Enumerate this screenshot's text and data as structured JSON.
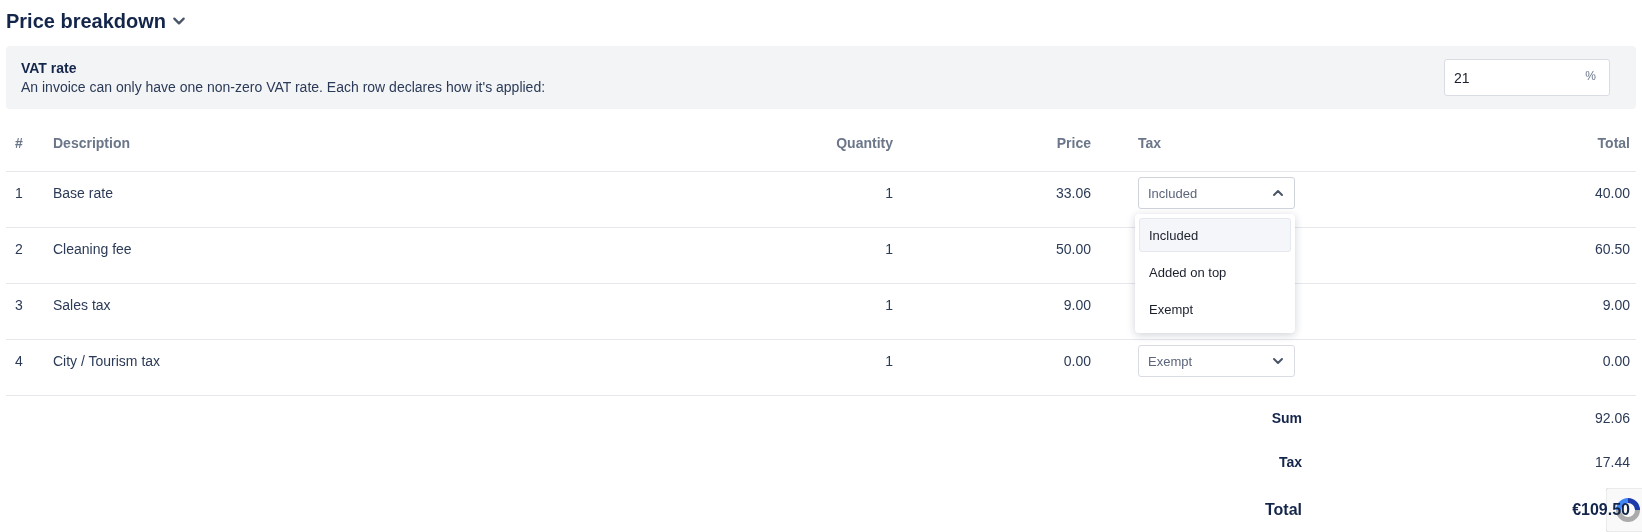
{
  "title": "Price breakdown",
  "vat": {
    "label": "VAT rate",
    "description": "An invoice can only have one non-zero VAT rate. Each row declares how it's applied:",
    "value": "21",
    "unit": "%"
  },
  "table": {
    "columns": [
      "#",
      "Description",
      "Quantity",
      "Price",
      "Tax",
      "Total"
    ],
    "rows": [
      {
        "number": "1",
        "description": "Base rate",
        "quantity": "1",
        "price": "33.06",
        "tax": {
          "value": "Included",
          "expanded": true,
          "options": [
            {
              "label": "Included",
              "selected": true
            },
            {
              "label": "Added on top",
              "selected": false
            },
            {
              "label": "Exempt",
              "selected": false
            }
          ]
        },
        "total": "40.00"
      },
      {
        "number": "2",
        "description": "Cleaning fee",
        "quantity": "1",
        "price": "50.00",
        "total": "60.50"
      },
      {
        "number": "3",
        "description": "Sales tax",
        "quantity": "1",
        "price": "9.00",
        "total": "9.00"
      },
      {
        "number": "4",
        "description": "City / Tourism tax",
        "quantity": "1",
        "price": "0.00",
        "tax": {
          "value": "Exempt",
          "expanded": false
        },
        "total": "0.00"
      }
    ]
  },
  "summary": [
    {
      "label": "Sum",
      "value": "92.06",
      "kind": "plain"
    },
    {
      "label": "Tax",
      "value": "17.44",
      "kind": "plain"
    },
    {
      "label": "Total",
      "value": "€109.50",
      "kind": "grand"
    }
  ]
}
